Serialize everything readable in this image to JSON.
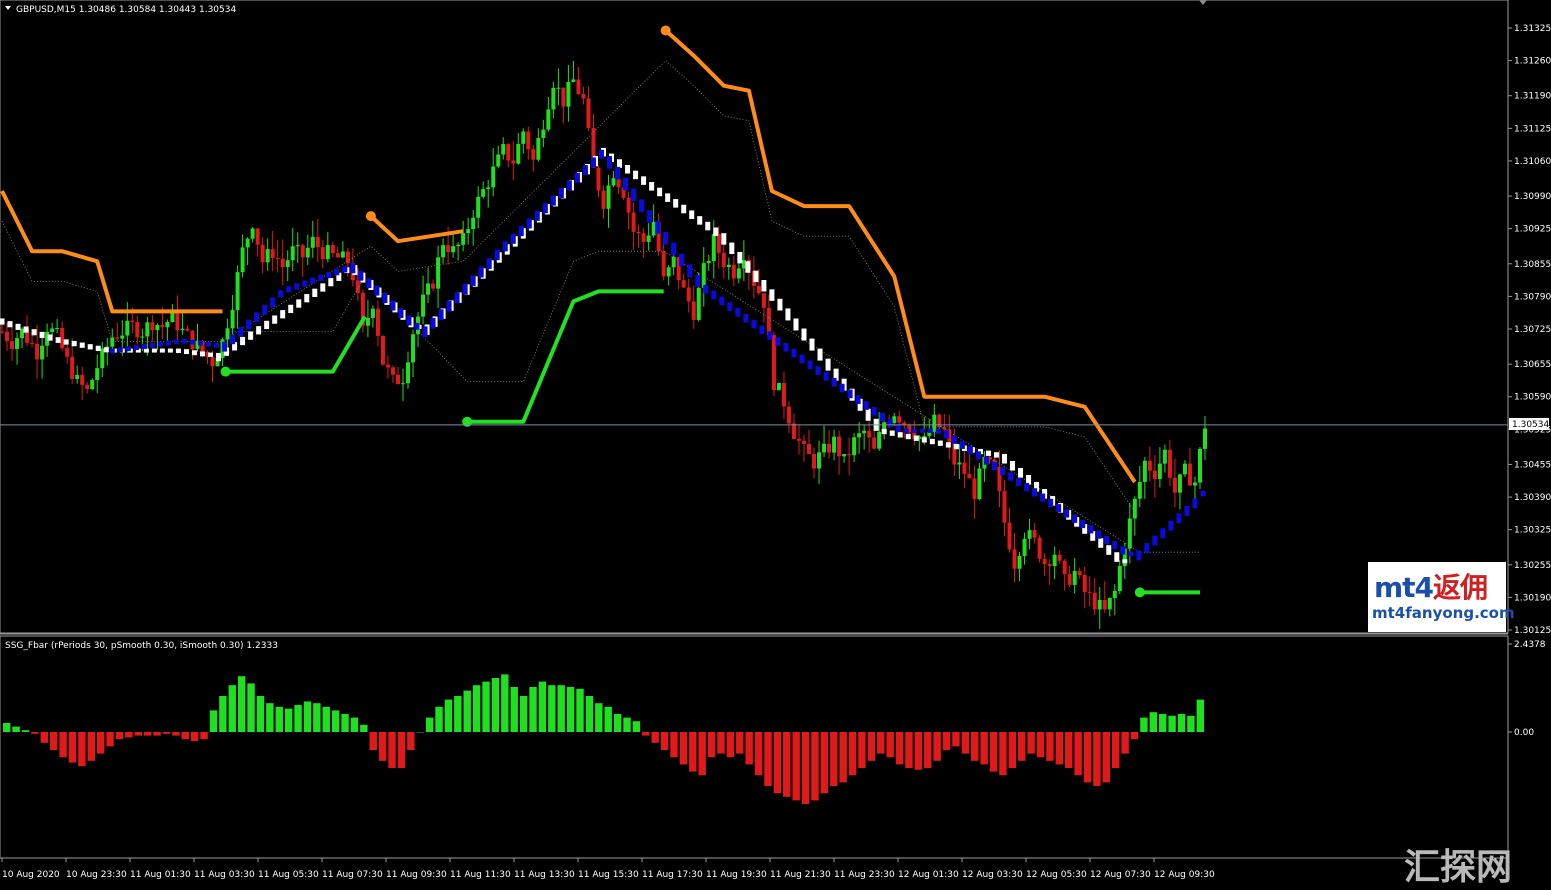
{
  "main_header": "GBPUSD,M15  1.30486 1.30584 1.30443 1.30534",
  "sub_header": "SSG_Fbar  (rPeriods 30, pSmooth 0.30, iSmooth 0.30)   1.2333",
  "current_price_label": "1.30534",
  "watermark": {
    "top_latin": "mt4",
    "top_cn": "返佣",
    "bottom": "mt4fanyong.com",
    "corner": "汇探网"
  },
  "colors": {
    "bull": "#1fe01f",
    "bear": "#e01a1a",
    "up_trend": "#ffffff",
    "down_trend": "#0a0adc",
    "resistance": "#ff8c1a",
    "support": "#22e022",
    "grid": "#3a3a3a"
  },
  "chart_data": [
    {
      "type": "candlestick",
      "symbol": "GBPUSD",
      "timeframe": "M15",
      "ylim": [
        1.30125,
        1.31325
      ],
      "y_ticks": [
        "1.31325",
        "1.31260",
        "1.31190",
        "1.31125",
        "1.31060",
        "1.30990",
        "1.30925",
        "1.30855",
        "1.30790",
        "1.30725",
        "1.30655",
        "1.30590",
        "1.30525",
        "1.30455",
        "1.30390",
        "1.30325",
        "1.30255",
        "1.30190",
        "1.30125"
      ],
      "x_ticks": [
        "10 Aug 2020",
        "10 Aug 23:30",
        "11 Aug 01:30",
        "11 Aug 03:30",
        "11 Aug 05:30",
        "11 Aug 07:30",
        "11 Aug 09:30",
        "11 Aug 11:30",
        "11 Aug 13:30",
        "11 Aug 15:30",
        "11 Aug 17:30",
        "11 Aug 19:30",
        "11 Aug 21:30",
        "11 Aug 23:30",
        "12 Aug 01:30",
        "12 Aug 03:30",
        "12 Aug 05:30",
        "12 Aug 07:30",
        "12 Aug 09:30"
      ],
      "current_price": 1.30534,
      "close_path": [
        [
          0,
          1.3072
        ],
        [
          10,
          1.307
        ],
        [
          20,
          1.3072
        ],
        [
          35,
          1.3068
        ],
        [
          45,
          1.3073
        ],
        [
          55,
          1.3071
        ],
        [
          65,
          1.3066
        ],
        [
          75,
          1.3062
        ],
        [
          85,
          1.306
        ],
        [
          95,
          1.3065
        ],
        [
          110,
          1.3071
        ],
        [
          120,
          1.3072
        ],
        [
          130,
          1.3073
        ],
        [
          140,
          1.3072
        ],
        [
          150,
          1.3074
        ],
        [
          160,
          1.3073
        ],
        [
          170,
          1.3075
        ],
        [
          180,
          1.3072
        ],
        [
          190,
          1.307
        ],
        [
          200,
          1.3068
        ],
        [
          210,
          1.3066
        ],
        [
          220,
          1.307
        ],
        [
          230,
          1.3078
        ],
        [
          240,
          1.3088
        ],
        [
          250,
          1.3094
        ],
        [
          260,
          1.3086
        ],
        [
          270,
          1.3088
        ],
        [
          280,
          1.3085
        ],
        [
          290,
          1.3088
        ],
        [
          300,
          1.3087
        ],
        [
          310,
          1.309
        ],
        [
          320,
          1.3088
        ],
        [
          330,
          1.3087
        ],
        [
          345,
          1.3086
        ],
        [
          352,
          1.3082
        ],
        [
          360,
          1.3072
        ],
        [
          370,
          1.3078
        ],
        [
          380,
          1.3066
        ],
        [
          390,
          1.3062
        ],
        [
          400,
          1.3063
        ],
        [
          410,
          1.3072
        ],
        [
          420,
          1.3078
        ],
        [
          430,
          1.3082
        ],
        [
          440,
          1.309
        ],
        [
          450,
          1.3088
        ],
        [
          460,
          1.309
        ],
        [
          470,
          1.3096
        ],
        [
          480,
          1.31
        ],
        [
          490,
          1.3104
        ],
        [
          500,
          1.3108
        ],
        [
          510,
          1.3106
        ],
        [
          520,
          1.3112
        ],
        [
          530,
          1.3106
        ],
        [
          540,
          1.3114
        ],
        [
          550,
          1.3122
        ],
        [
          560,
          1.3118
        ],
        [
          570,
          1.3122
        ],
        [
          580,
          1.3118
        ],
        [
          590,
          1.3104
        ],
        [
          600,
          1.3098
        ],
        [
          610,
          1.3104
        ],
        [
          620,
          1.31
        ],
        [
          630,
          1.3092
        ],
        [
          640,
          1.309
        ],
        [
          650,
          1.3094
        ],
        [
          660,
          1.3082
        ],
        [
          670,
          1.3086
        ],
        [
          680,
          1.308
        ],
        [
          690,
          1.3076
        ],
        [
          700,
          1.3084
        ],
        [
          710,
          1.309
        ],
        [
          720,
          1.3086
        ],
        [
          730,
          1.3084
        ],
        [
          740,
          1.3088
        ],
        [
          750,
          1.3082
        ],
        [
          760,
          1.3078
        ],
        [
          770,
          1.3062
        ],
        [
          780,
          1.3058
        ],
        [
          790,
          1.3052
        ],
        [
          800,
          1.3048
        ],
        [
          810,
          1.3046
        ],
        [
          820,
          1.3048
        ],
        [
          830,
          1.305
        ],
        [
          840,
          1.3046
        ],
        [
          850,
          1.305
        ],
        [
          860,
          1.3052
        ],
        [
          870,
          1.3048
        ],
        [
          880,
          1.3054
        ],
        [
          890,
          1.3056
        ],
        [
          900,
          1.3054
        ],
        [
          910,
          1.3052
        ],
        [
          920,
          1.305
        ],
        [
          930,
          1.3054
        ],
        [
          940,
          1.3052
        ],
        [
          950,
          1.3046
        ],
        [
          960,
          1.3044
        ],
        [
          970,
          1.304
        ],
        [
          980,
          1.3046
        ],
        [
          990,
          1.3044
        ],
        [
          1000,
          1.3034
        ],
        [
          1010,
          1.3026
        ],
        [
          1020,
          1.3032
        ],
        [
          1030,
          1.303
        ],
        [
          1040,
          1.3026
        ],
        [
          1050,
          1.3028
        ],
        [
          1060,
          1.3022
        ],
        [
          1070,
          1.3024
        ],
        [
          1080,
          1.302
        ],
        [
          1090,
          1.3018
        ],
        [
          1100,
          1.3016
        ],
        [
          1110,
          1.302
        ],
        [
          1120,
          1.303
        ],
        [
          1130,
          1.3038
        ],
        [
          1140,
          1.3046
        ],
        [
          1150,
          1.3044
        ],
        [
          1160,
          1.3048
        ],
        [
          1170,
          1.304
        ],
        [
          1180,
          1.3044
        ],
        [
          1190,
          1.3042
        ],
        [
          1200,
          1.30534
        ]
      ],
      "up_trend_line": [
        [
          0,
          1.3074
        ],
        [
          60,
          1.307
        ],
        [
          110,
          1.3068
        ],
        [
          180,
          1.3068
        ],
        [
          215,
          1.3067
        ],
        [
          350,
          1.3085
        ],
        [
          420,
          1.3072
        ],
        [
          600,
          1.3108
        ],
        [
          720,
          1.3091
        ],
        [
          780,
          1.3077
        ],
        [
          880,
          1.3052
        ],
        [
          1000,
          1.3047
        ],
        [
          1120,
          1.3026
        ]
      ],
      "down_trend_line": [
        [
          110,
          1.3068
        ],
        [
          180,
          1.307
        ],
        [
          220,
          1.3069
        ],
        [
          280,
          1.308
        ],
        [
          350,
          1.3085
        ],
        [
          420,
          1.3072
        ],
        [
          500,
          1.3089
        ],
        [
          600,
          1.3108
        ],
        [
          700,
          1.3081
        ],
        [
          900,
          1.3052
        ],
        [
          940,
          1.3052
        ],
        [
          1130,
          1.3027
        ],
        [
          1200,
          1.304
        ]
      ],
      "resistance_line": [
        [
          0,
          1.31
        ],
        [
          30,
          1.3088
        ],
        [
          60,
          1.3088
        ],
        [
          95,
          1.3086
        ],
        [
          110,
          1.3076
        ],
        [
          220,
          1.3076
        ],
        [
          368,
          1.3095
        ],
        [
          395,
          1.309
        ],
        [
          460,
          1.3092
        ],
        [
          662,
          1.3132
        ],
        [
          690,
          1.3127
        ],
        [
          720,
          1.3121
        ],
        [
          745,
          1.312
        ],
        [
          768,
          1.31
        ],
        [
          800,
          1.3097
        ],
        [
          845,
          1.3097
        ],
        [
          890,
          1.3083
        ],
        [
          920,
          1.3059
        ],
        [
          1040,
          1.3059
        ],
        [
          1080,
          1.3057
        ],
        [
          1130,
          1.3042
        ]
      ],
      "support_line": [
        [
          223,
          1.3064
        ],
        [
          330,
          1.3064
        ],
        [
          362,
          1.3075
        ],
        [
          464,
          1.3054
        ],
        [
          520,
          1.3054
        ],
        [
          570,
          1.3078
        ],
        [
          595,
          1.308
        ],
        [
          660,
          1.308
        ],
        [
          1135,
          1.302
        ],
        [
          1195,
          1.302
        ]
      ],
      "support_dots": [
        [
          223,
          1.3064
        ],
        [
          464,
          1.3054
        ],
        [
          1135,
          1.302
        ]
      ],
      "resistance_dots": [
        [
          368,
          1.3095
        ],
        [
          662,
          1.3132
        ]
      ]
    },
    {
      "type": "bar",
      "name": "SSG_Fbar",
      "ylim": [
        -1.2,
        2.4378
      ],
      "y_ticks": [
        "2.4378",
        "0.00"
      ],
      "values": [
        0.25,
        0.15,
        0.05,
        -0.05,
        -0.3,
        -0.5,
        -0.7,
        -0.85,
        -0.95,
        -0.8,
        -0.6,
        -0.4,
        -0.2,
        -0.15,
        -0.1,
        -0.1,
        -0.1,
        -0.05,
        -0.1,
        -0.2,
        -0.25,
        -0.2,
        0.6,
        1.0,
        1.3,
        1.55,
        1.35,
        1.0,
        0.8,
        0.7,
        0.65,
        0.75,
        0.85,
        0.8,
        0.7,
        0.6,
        0.5,
        0.4,
        0.2,
        -0.5,
        -0.8,
        -1.0,
        -1.0,
        -0.5,
        0.0,
        0.4,
        0.7,
        0.9,
        1.0,
        1.15,
        1.3,
        1.4,
        1.5,
        1.6,
        1.25,
        1.0,
        1.25,
        1.4,
        1.3,
        1.3,
        1.25,
        1.2,
        1.0,
        0.8,
        0.7,
        0.5,
        0.4,
        0.3,
        -0.1,
        -0.3,
        -0.5,
        -0.7,
        -0.9,
        -1.1,
        -1.2,
        -0.7,
        -0.6,
        -0.7,
        -0.6,
        -0.9,
        -1.2,
        -1.5,
        -1.7,
        -1.8,
        -1.9,
        -2.0,
        -1.9,
        -1.7,
        -1.5,
        -1.4,
        -1.2,
        -1.0,
        -0.8,
        -0.6,
        -0.7,
        -0.9,
        -1.0,
        -1.05,
        -1.0,
        -0.8,
        -0.5,
        -0.4,
        -0.6,
        -0.8,
        -0.9,
        -1.1,
        -1.2,
        -1.0,
        -0.8,
        -0.6,
        -0.7,
        -0.8,
        -0.9,
        -1.0,
        -1.2,
        -1.4,
        -1.5,
        -1.4,
        -1.0,
        -0.6,
        -0.2,
        0.4,
        0.55,
        0.5,
        0.45,
        0.5,
        0.45,
        0.9
      ]
    }
  ]
}
